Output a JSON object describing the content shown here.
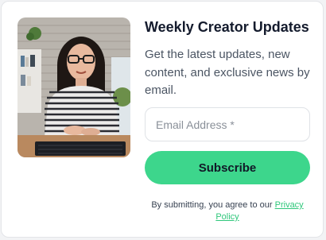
{
  "card": {
    "title": "Weekly Creator Updates",
    "description": "Get the latest updates, new content, and exclusive news by email.",
    "email_placeholder": "Email Address *",
    "email_value": "",
    "subscribe_label": "Subscribe",
    "disclaimer_text": "By submitting, you agree to our ",
    "privacy_link": "Privacy Policy"
  },
  "colors": {
    "accent": "#3dd68c",
    "link": "#2fc77b",
    "title": "#141b2d"
  },
  "image": {
    "alt_semantic": "woman-at-laptop-photo"
  }
}
